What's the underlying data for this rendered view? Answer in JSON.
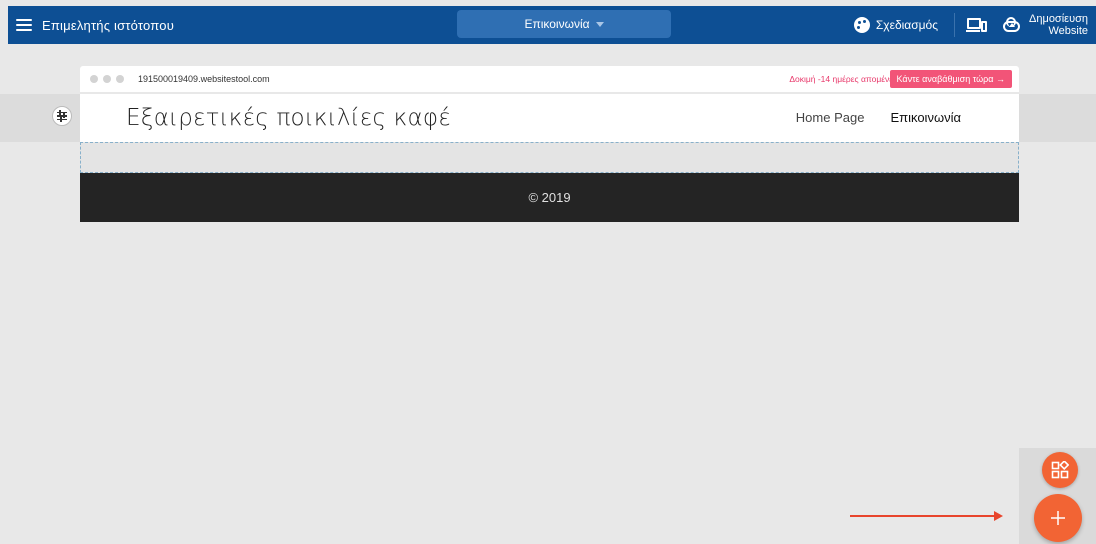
{
  "topbar": {
    "app_title": "Επιμελητής ιστότοπου",
    "page_selector": "Επικοινωνία",
    "design_label": "Σχεδιασμός",
    "publish_line1": "Δημοσίευση",
    "publish_line2": "Website",
    "color": "#0d4f94"
  },
  "browser": {
    "url": "191500019409.websitestool.com",
    "trial_text": "Δοκιμή -14 ημέρες απομένει",
    "upgrade_label": "Κάντε αναβάθμιση τώρα →"
  },
  "site": {
    "title": "Εξαιρετικές ποικιλίες καφέ",
    "nav": [
      "Home Page",
      "Επικοινωνία"
    ],
    "footer": "© 2019"
  },
  "fabs": {
    "widgets_icon": "widgets-icon",
    "add_icon": "plus-icon",
    "accent": "#f26434"
  }
}
